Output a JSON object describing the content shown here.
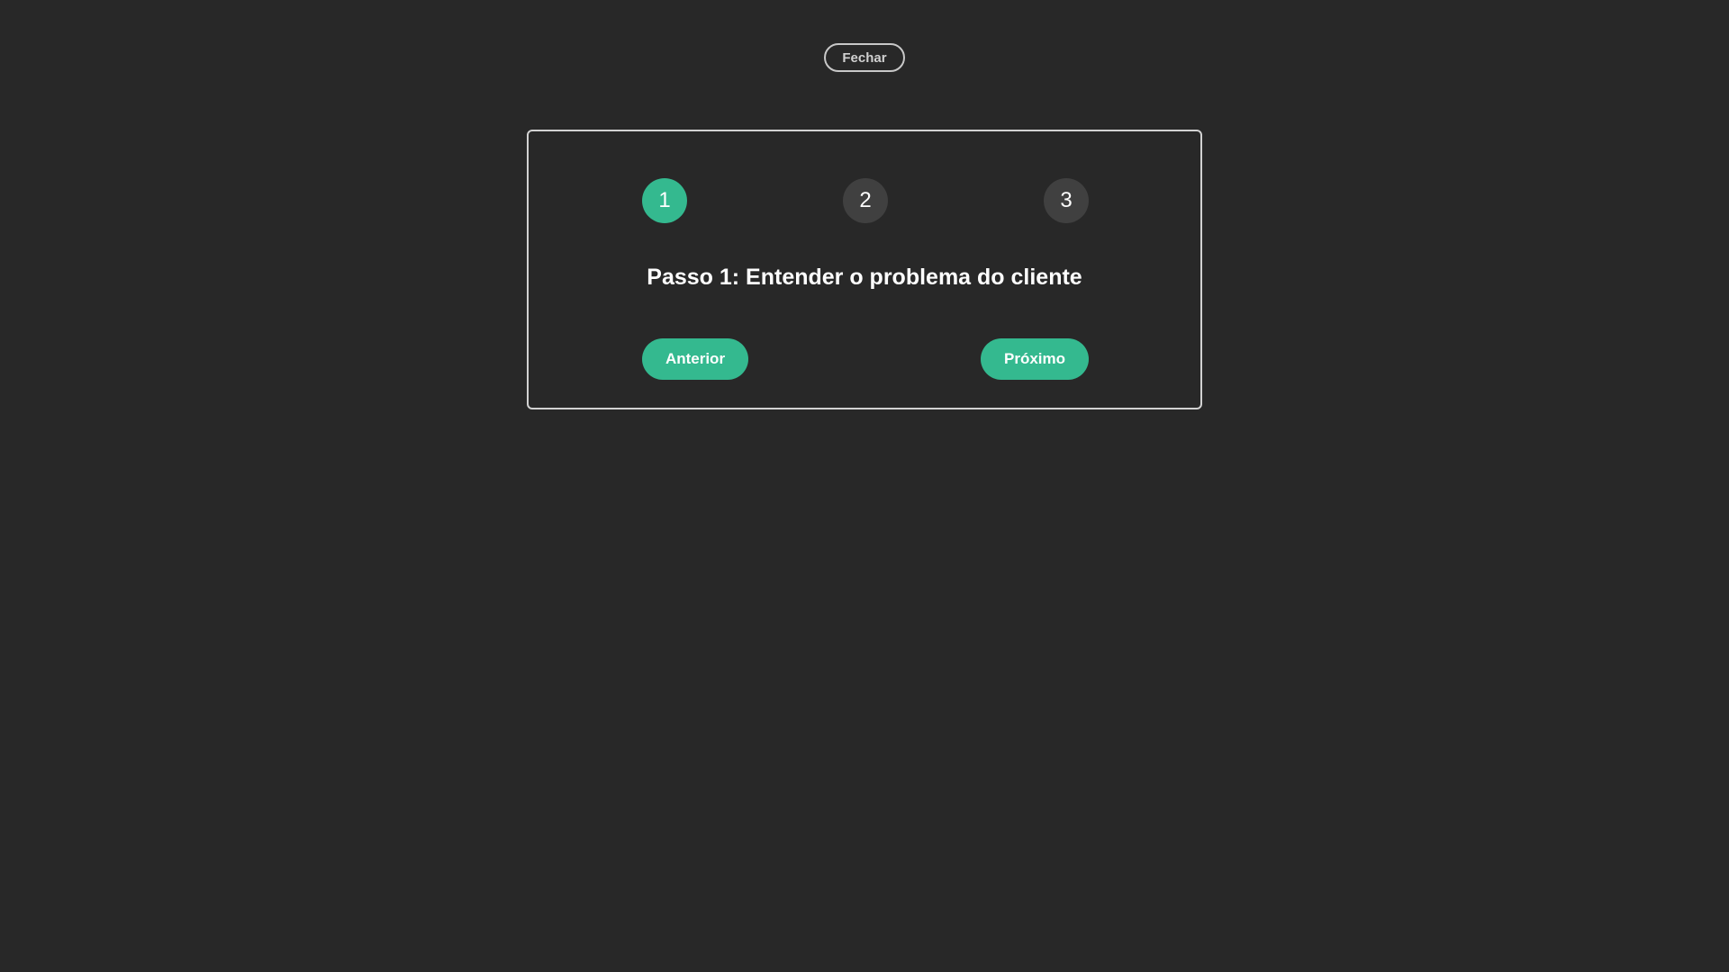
{
  "header": {
    "close_label": "Fechar"
  },
  "wizard": {
    "steps": [
      {
        "label": "1",
        "state": "active"
      },
      {
        "label": "2",
        "state": "inactive"
      },
      {
        "label": "3",
        "state": "inactive"
      }
    ],
    "current_step_title": "Passo 1: Entender o problema do cliente",
    "prev_label": "Anterior",
    "next_label": "Próximo"
  },
  "colors": {
    "background": "#282828",
    "accent": "#34b98f",
    "step_inactive": "#404040",
    "card_border": "#d2d2d2"
  }
}
